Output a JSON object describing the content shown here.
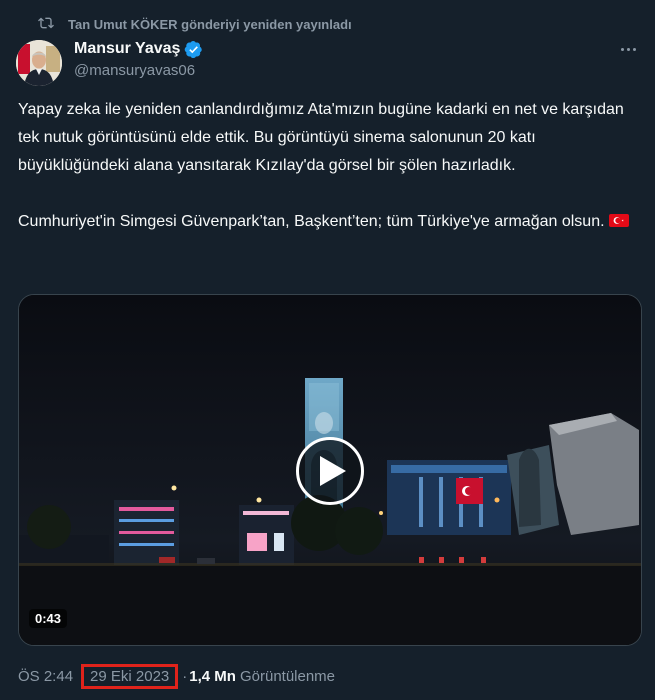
{
  "repost": {
    "text": "Tan Umut KÖKER gönderiyi yeniden yayınladı",
    "icon": "repost-icon"
  },
  "author": {
    "name": "Mansur Yavaş",
    "handle": "@mansuryavas06",
    "verified_icon": "verified-badge-icon",
    "verified_color": "#1d9bf0"
  },
  "tweet": {
    "paragraph1": "Yapay zeka ile yeniden canlandırdığımız Ata'mızın bugüne kadarki en net ve karşıdan tek nutuk görüntüsünü elde ettik. Bu görüntüyü sinema salonunun 20 katı büyüklüğündeki alana yansıtarak Kızılay'da görsel bir şölen hazırladık.",
    "paragraph2": "Cumhuriyet'in Simgesi Güvenpark’tan, Başkent’ten; tüm Türkiye'ye armağan olsun.",
    "emoji": "turkey-flag-emoji"
  },
  "video": {
    "duration": "0:43",
    "play_icon": "play-icon"
  },
  "meta": {
    "time": "ÖS 2:44",
    "separator": "·",
    "date": "29 Eki 2023",
    "views_count": "1,4 Mn",
    "views_label": "Görüntülenme"
  },
  "colors": {
    "background": "#15202b",
    "secondary_text": "#8b98a5",
    "highlight_box": "#e0231b"
  }
}
